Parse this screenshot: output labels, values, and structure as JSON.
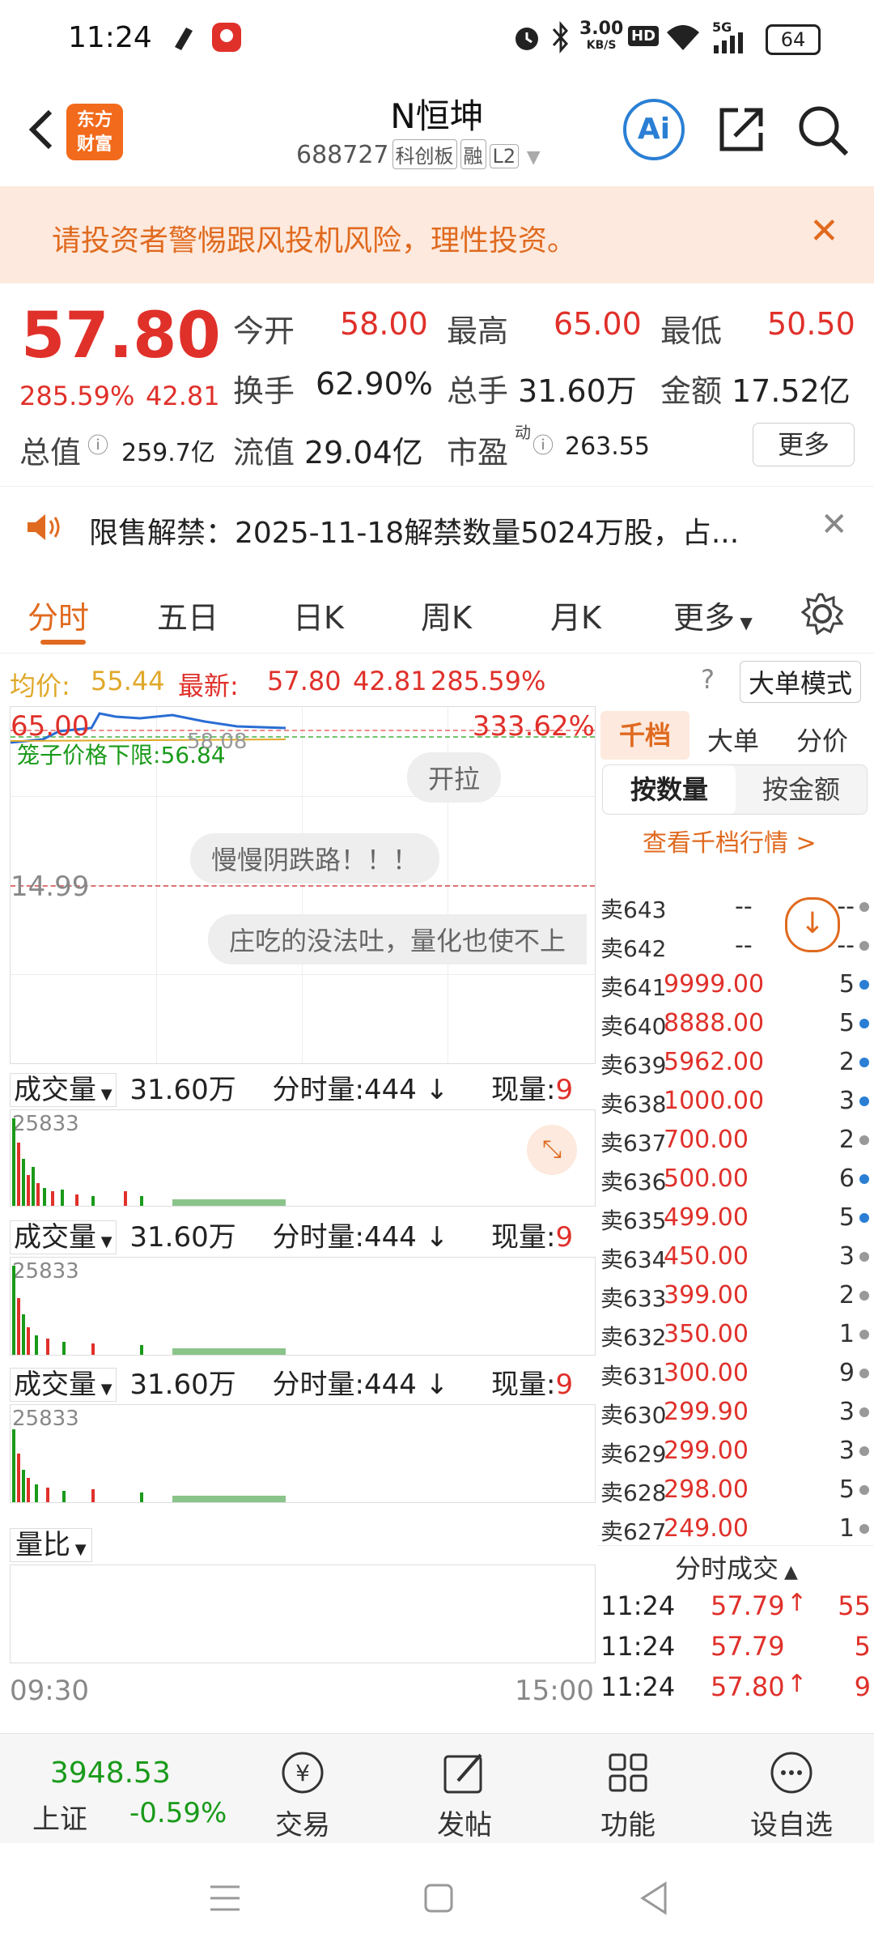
{
  "status_bar": {
    "time": "11:24",
    "net_speed": "3.00",
    "net_unit": "KB/S",
    "hd": "HD",
    "signal": "5G",
    "battery": "64"
  },
  "header": {
    "logo_line1": "东方",
    "logo_line2": "财富",
    "stock_name": "N恒坤",
    "stock_code": "688727",
    "tags": [
      "科创板",
      "融",
      "L2"
    ]
  },
  "warning": {
    "text": "请投资者警惕跟风投机风险，理性投资。"
  },
  "quote": {
    "price": "57.80",
    "change_pct": "285.59%",
    "change": "42.81",
    "open_label": "今开",
    "open": "58.00",
    "high_label": "最高",
    "high": "65.00",
    "low_label": "最低",
    "low": "50.50",
    "turnover_label": "换手",
    "turnover": "62.90%",
    "volume_label": "总手",
    "volume": "31.60万",
    "amount_label": "金额",
    "amount": "17.52亿",
    "mktcap_label": "总值",
    "mktcap": "259.7亿",
    "float_label": "流值",
    "float": "29.04亿",
    "pe_label": "市盈",
    "pe_sup": "动",
    "pe": "263.55",
    "more": "更多"
  },
  "notice": {
    "text": "限售解禁：2025-11-18解禁数量5024万股，占..."
  },
  "tabs": [
    "分时",
    "五日",
    "日K",
    "周K",
    "月K",
    "更多"
  ],
  "infoline": {
    "avg_label": "均价:",
    "avg": "55.44",
    "last_label": "最新:",
    "last": "57.80",
    "chg": "42.81",
    "pct": "285.59%",
    "big_order_mode": "大单模式"
  },
  "chart": {
    "top_price": "65.00",
    "top_pct": "333.62%",
    "mid_price": "14.99",
    "limit_label": "笼子价格下限:",
    "limit_value": "56.84",
    "limit_prev": "58.08",
    "bubbles": [
      "开拉",
      "慢慢阴跌路！！！",
      "庄吃的没法吐，量化也使不上"
    ],
    "time_start": "09:30",
    "time_end": "15:00"
  },
  "volume_panels": [
    {
      "label": "成交量",
      "total": "31.60万",
      "period_label": "分时量:",
      "period": "444",
      "now_label": "现量:",
      "now": "9",
      "max": "25833"
    },
    {
      "label": "成交量",
      "total": "31.60万",
      "period_label": "分时量:",
      "period": "444",
      "now_label": "现量:",
      "now": "9",
      "max": "25833"
    },
    {
      "label": "成交量",
      "total": "31.60万",
      "period_label": "分时量:",
      "period": "444",
      "now_label": "现量:",
      "now": "9",
      "max": "25833"
    }
  ],
  "ratio_panel": {
    "label": "量比"
  },
  "orderbook": {
    "tabs": [
      "千档",
      "大单",
      "分价"
    ],
    "sub_tabs": [
      "按数量",
      "按金额"
    ],
    "view_link": "查看千档行情 >",
    "rows": [
      {
        "label": "卖643",
        "price": "--",
        "qty": "--",
        "dot": "gray"
      },
      {
        "label": "卖642",
        "price": "--",
        "qty": "--",
        "dot": "gray"
      },
      {
        "label": "卖641",
        "price": "9999.00",
        "qty": "5",
        "dot": "blue"
      },
      {
        "label": "卖640",
        "price": "8888.00",
        "qty": "5",
        "dot": "blue"
      },
      {
        "label": "卖639",
        "price": "5962.00",
        "qty": "2",
        "dot": "blue"
      },
      {
        "label": "卖638",
        "price": "1000.00",
        "qty": "3",
        "dot": "blue"
      },
      {
        "label": "卖637",
        "price": "700.00",
        "qty": "2",
        "dot": "gray"
      },
      {
        "label": "卖636",
        "price": "500.00",
        "qty": "6",
        "dot": "blue"
      },
      {
        "label": "卖635",
        "price": "499.00",
        "qty": "5",
        "dot": "blue"
      },
      {
        "label": "卖634",
        "price": "450.00",
        "qty": "3",
        "dot": "gray"
      },
      {
        "label": "卖633",
        "price": "399.00",
        "qty": "2",
        "dot": "gray"
      },
      {
        "label": "卖632",
        "price": "350.00",
        "qty": "1",
        "dot": "gray"
      },
      {
        "label": "卖631",
        "price": "300.00",
        "qty": "9",
        "dot": "gray"
      },
      {
        "label": "卖630",
        "price": "299.90",
        "qty": "3",
        "dot": "gray"
      },
      {
        "label": "卖629",
        "price": "299.00",
        "qty": "3",
        "dot": "gray"
      },
      {
        "label": "卖628",
        "price": "298.00",
        "qty": "5",
        "dot": "gray"
      },
      {
        "label": "卖627",
        "price": "249.00",
        "qty": "1",
        "dot": "gray"
      }
    ],
    "trades_title": "分时成交",
    "trades": [
      {
        "time": "11:24",
        "price": "57.79",
        "arrow": "↑",
        "qty": "55"
      },
      {
        "time": "11:24",
        "price": "57.79",
        "arrow": "",
        "qty": "5"
      },
      {
        "time": "11:24",
        "price": "57.80",
        "arrow": "↑",
        "qty": "9"
      }
    ]
  },
  "index": {
    "value": "3948.53",
    "name": "上证",
    "pct": "-0.59%"
  },
  "bottom_nav": [
    "交易",
    "发帖",
    "功能",
    "设自选"
  ]
}
